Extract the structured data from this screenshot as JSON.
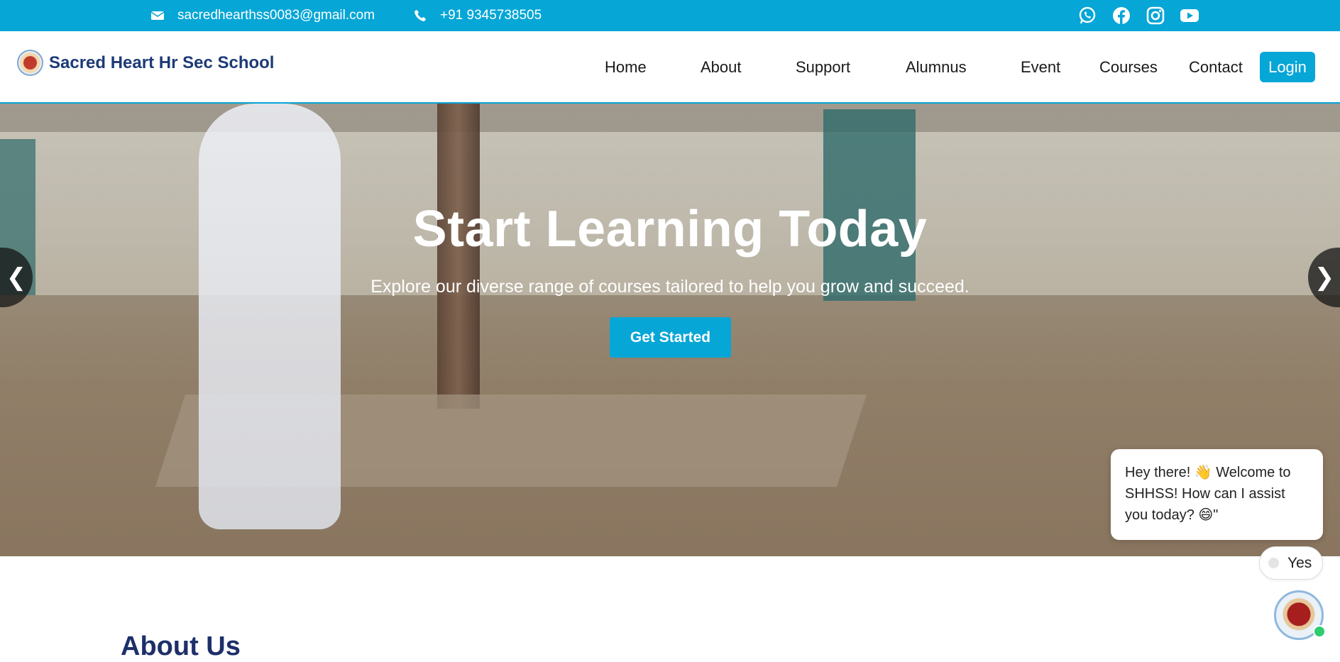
{
  "topbar": {
    "email": "sacredhearthss0083@gmail.com",
    "phone": "+91 9345738505",
    "social_icons": [
      "whatsapp-icon",
      "facebook-icon",
      "instagram-icon",
      "youtube-icon"
    ]
  },
  "brand": {
    "name": "Sacred Heart Hr Sec School",
    "logo_icon": "school-crest-logo"
  },
  "nav": {
    "items": [
      "Home",
      "About",
      "Support",
      "Alumnus",
      "Event",
      "Courses",
      "Contact"
    ],
    "login_label": "Login"
  },
  "hero": {
    "title": "Start Learning Today",
    "subtitle": "Explore our diverse range of courses tailored to help you grow and succeed.",
    "cta_label": "Get Started",
    "prev_label": "❮",
    "next_label": "❯"
  },
  "about": {
    "title": "About Us"
  },
  "chat": {
    "message": "Hey there! 👋 Welcome to SHHSS! How can I assist you today? 😄\"",
    "reply_option": "Yes"
  },
  "colors": {
    "accent": "#06a6d6",
    "brand_text": "#1d3a78",
    "heading": "#1d2f6a"
  }
}
